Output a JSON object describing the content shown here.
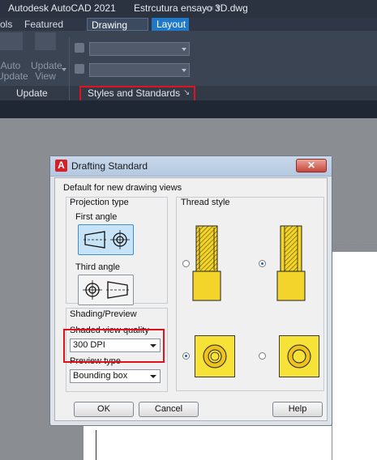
{
  "window": {
    "title_app": "Autodesk AutoCAD 2021",
    "title_file": "Estrcutura ensayo 3D.dwg",
    "workspace_menu": "▭ ▾"
  },
  "ribbon_tabs": [
    {
      "label": "ols"
    },
    {
      "label": "Featured Apps"
    },
    {
      "label": "Drawing View"
    },
    {
      "label": "Layout"
    }
  ],
  "ribbon": {
    "auto_update_label": "Auto\nUpdate",
    "update_view_label": "Update\nView",
    "update_panel_title": "Update",
    "styles_panel_title": "Styles and Standards",
    "launcher_icon": "↘"
  },
  "dialog": {
    "title": "Drafting Standard",
    "close_label": "✕",
    "subtitle": "Default for new drawing views",
    "projection_type_label": "Projection type",
    "first_angle_label": "First angle",
    "third_angle_label": "Third angle",
    "thread_style_label": "Thread style",
    "shading_preview_label": "Shading/Preview",
    "shaded_quality_label": "Shaded view quality",
    "shaded_quality_value": "300 DPI",
    "preview_type_label": "Preview type",
    "preview_type_value": "Bounding box",
    "ok_label": "OK",
    "cancel_label": "Cancel",
    "help_label": "Help"
  },
  "colors": {
    "highlight_red": "#e0131d",
    "thread_yellow": "#f7e238",
    "selected_blue": "#c6e3f7"
  }
}
